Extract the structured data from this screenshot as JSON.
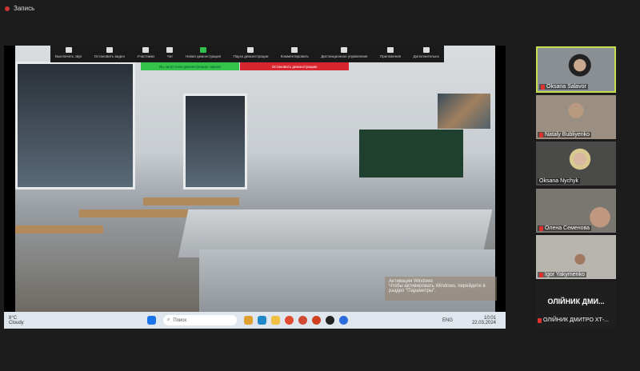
{
  "recording": {
    "label": "Запись"
  },
  "toolbar": {
    "items": [
      {
        "label": "Выключить звук",
        "icon": "microphone-icon"
      },
      {
        "label": "Остановить видео",
        "icon": "video-camera-icon"
      },
      {
        "label": "Участники",
        "icon": "participants-icon",
        "count": "41"
      },
      {
        "label": "Чат",
        "icon": "chat-icon"
      },
      {
        "label": "Новая демонстрация",
        "icon": "share-screen-icon"
      },
      {
        "label": "Пауза демонстрации",
        "icon": "pause-icon"
      },
      {
        "label": "Комментировать",
        "icon": "pen-icon"
      },
      {
        "label": "Дистанционное управление",
        "icon": "remote-control-icon"
      },
      {
        "label": "Приложения",
        "icon": "apps-icon"
      },
      {
        "label": "Дополнительно",
        "icon": "more-icon"
      }
    ]
  },
  "banners": {
    "sharing": "Вы запустили демонстрацию экрана",
    "stop": "Остановить демонстрацию"
  },
  "watermark": {
    "line1": "Активация Windows",
    "line2": "Чтобы активировать Windows, перейдите в раздел \"Параметры\"."
  },
  "taskbar": {
    "weather_temp": "8°C",
    "weather_text": "Cloudy",
    "search_placeholder": "Поиск",
    "lang": "ENG",
    "time": "10:01",
    "date": "22.03.2024"
  },
  "participants": [
    {
      "name": "Oksana Salavor",
      "muted": true,
      "active": true,
      "bg": "#8a8f94"
    },
    {
      "name": "Nataly Bubliyenko",
      "muted": true,
      "bg": "#9a8f80"
    },
    {
      "name": "Oksana Nychyk",
      "muted": false,
      "bg": "#4a4a48"
    },
    {
      "name": "Олена Семенова",
      "muted": true,
      "bg": "#7a7670"
    },
    {
      "name": "Igor Yakymenko",
      "muted": true,
      "bg": "#b8b4ae"
    },
    {
      "name": "ОЛІЙНИК ДМИТРО ХТ-...",
      "display": "ОЛІЙНИК ДМИ...",
      "muted": true
    }
  ],
  "colors": {
    "active_speaker": "#c5e04c",
    "sharing_green": "#35c24a",
    "stop_red": "#d9262e"
  }
}
